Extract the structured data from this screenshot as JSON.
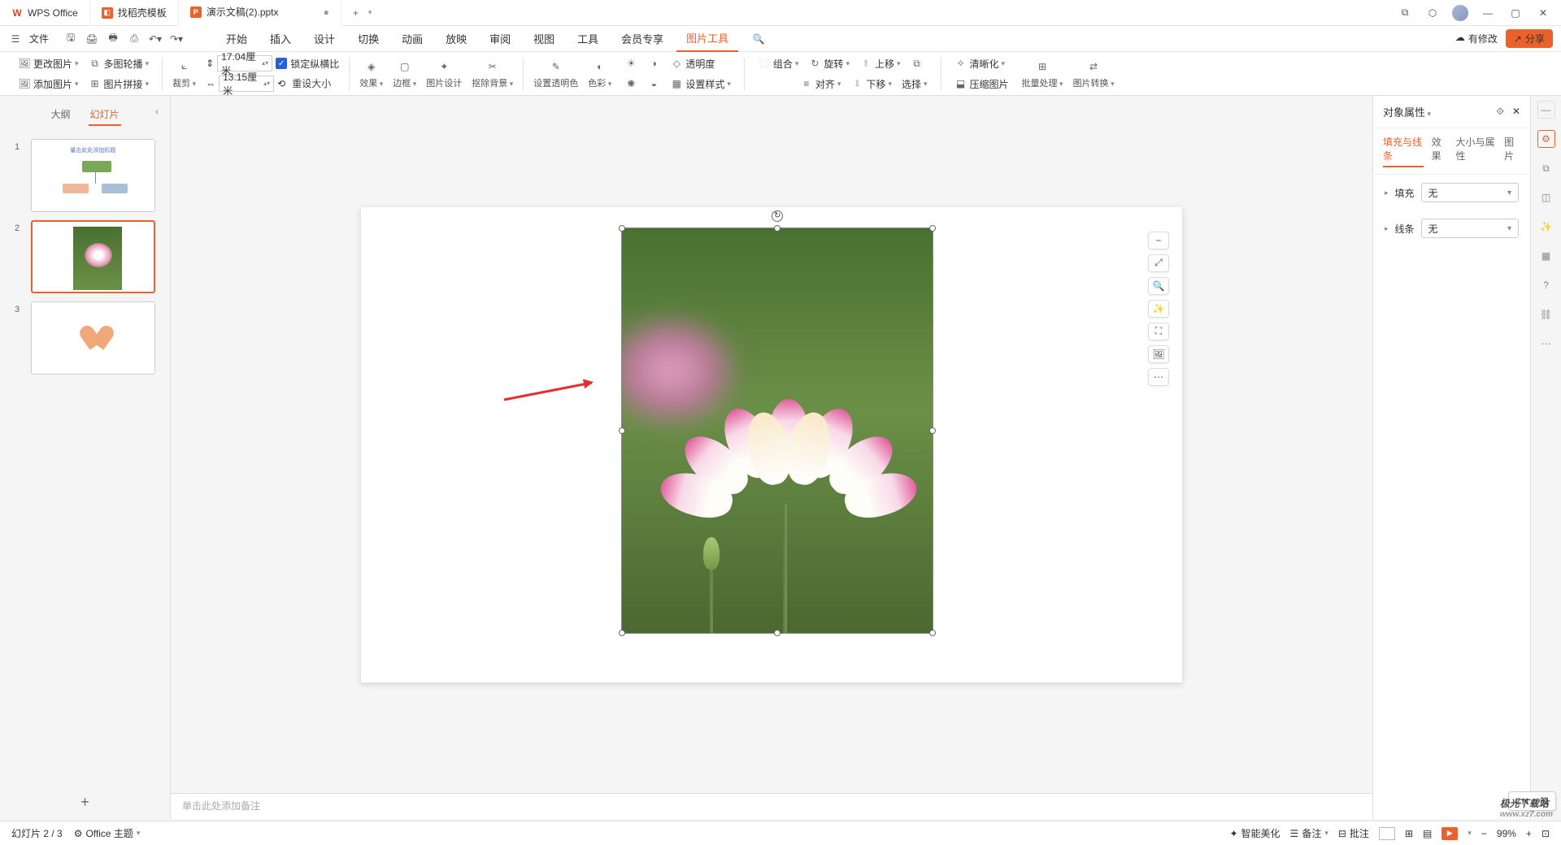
{
  "titlebar": {
    "tabs": [
      {
        "icon": "W",
        "label": "WPS Office",
        "color": "#d24726"
      },
      {
        "icon": "◧",
        "label": "找稻壳模板",
        "color": "#e9622b"
      },
      {
        "icon": "P",
        "label": "演示文稿(2).pptx",
        "color": "#e9622b",
        "dirty": "●"
      }
    ],
    "add": "+"
  },
  "menubar": {
    "file": "文件",
    "tabs": [
      "开始",
      "插入",
      "设计",
      "切换",
      "动画",
      "放映",
      "审阅",
      "视图",
      "工具",
      "会员专享",
      "图片工具"
    ],
    "active": 10,
    "has_revision": "有修改",
    "share": "分享"
  },
  "ribbon": {
    "g1": {
      "change": "更改图片",
      "addimg": "添加图片",
      "morewrap": "多图轮播",
      "imgjoin": "图片拼接"
    },
    "g2": {
      "crop": "裁剪",
      "w": "17.04厘米",
      "h": "13.15厘米",
      "lock": "锁定纵横比",
      "reset": "重设大小"
    },
    "g3": {
      "effect": "效果",
      "border": "边框",
      "design": "图片设计",
      "removebg": "抠除背景",
      "settrans": "设置透明色",
      "color": "色彩",
      "trans": "透明度",
      "setstyle": "设置样式"
    },
    "g4": {
      "combine": "组合",
      "rotate": "旋转",
      "align": "对齐",
      "up": "上移",
      "down": "下移",
      "select": "选择"
    },
    "g5": {
      "sharpen": "清晰化",
      "compress": "压缩图片",
      "batch": "批量处理",
      "convert": "图片转换"
    }
  },
  "slidepanel": {
    "outline": "大纲",
    "slides": "幻灯片",
    "active": 1,
    "slide_count": 3,
    "slide1_title": "量击此处添加标题"
  },
  "canvas": {
    "notes_placeholder": "单击此处添加备注"
  },
  "floatbar": [
    "−",
    "⤢",
    "🔍",
    "✨",
    "⛶",
    "🖼",
    "⋯"
  ],
  "properties": {
    "title": "对象属性",
    "tabs": [
      "填充与线条",
      "效果",
      "大小与属性",
      "图片"
    ],
    "active": 0,
    "fill": {
      "label": "填充",
      "value": "无"
    },
    "line": {
      "label": "线条",
      "value": "无"
    }
  },
  "sidebar_icons": [
    "sliders",
    "clone",
    "box",
    "magic",
    "layout",
    "help",
    "link",
    "more"
  ],
  "statusbar": {
    "slidepos": "幻灯片 2 / 3",
    "theme": "Office 主题",
    "beautify": "智能美化",
    "note": "备注",
    "review": "批注",
    "zoom": "99%",
    "langpill": "CH ♫ 简"
  },
  "watermark": {
    "logo": "极光下载站",
    "url": "www.xz7.com"
  }
}
